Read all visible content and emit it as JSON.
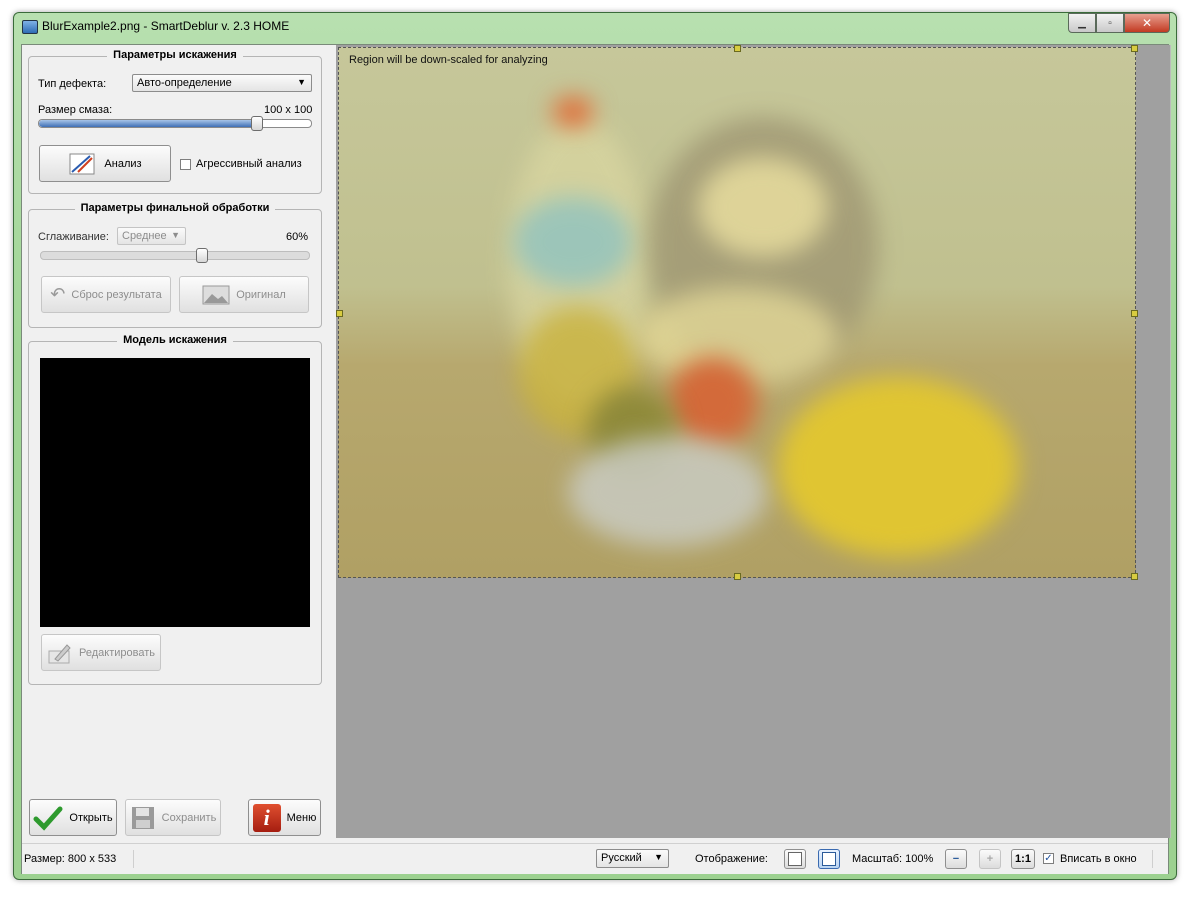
{
  "window": {
    "title": "BlurExample2.png - SmartDeblur v. 2.3 HOME",
    "close_label": "✕",
    "minimize_label": "▭",
    "maximize_label": "▫"
  },
  "distortion_params": {
    "title": "Параметры искажения",
    "defect_type_label": "Тип дефекта:",
    "defect_type_value": "Авто-определение",
    "blur_size_label": "Размер смаза:",
    "blur_size_value": "100 x 100",
    "blur_size_fraction": 0.8,
    "analyze_button": "Анализ",
    "aggressive_label": "Агрессивный анализ",
    "aggressive_checked": false
  },
  "final_processing": {
    "title": "Параметры финальной обработки",
    "smoothing_label": "Сглаживание:",
    "smoothing_value": "Среднее",
    "smoothing_percent": "60%",
    "smoothing_fraction": 0.6,
    "reset_button": "Сброс результата",
    "original_button": "Оригинал"
  },
  "distortion_model": {
    "title": "Модель искажения",
    "edit_button": "Редактировать"
  },
  "bottom_buttons": {
    "open": "Открыть",
    "save": "Сохранить",
    "menu": "Меню"
  },
  "canvas": {
    "region_note": "Region will be down-scaled for analyzing"
  },
  "status": {
    "size_text": "Размер: 800 x 533",
    "language": "Русский",
    "display_label": "Отображение:",
    "zoom_text": "Масштаб: 100%",
    "fit_label": "Вписать в окно",
    "fit_checked": true,
    "one_to_one": "1:1"
  },
  "icons": {
    "zoom_out": "−",
    "zoom_in": "+",
    "checkmark": "✓",
    "dropdown": "▼"
  }
}
